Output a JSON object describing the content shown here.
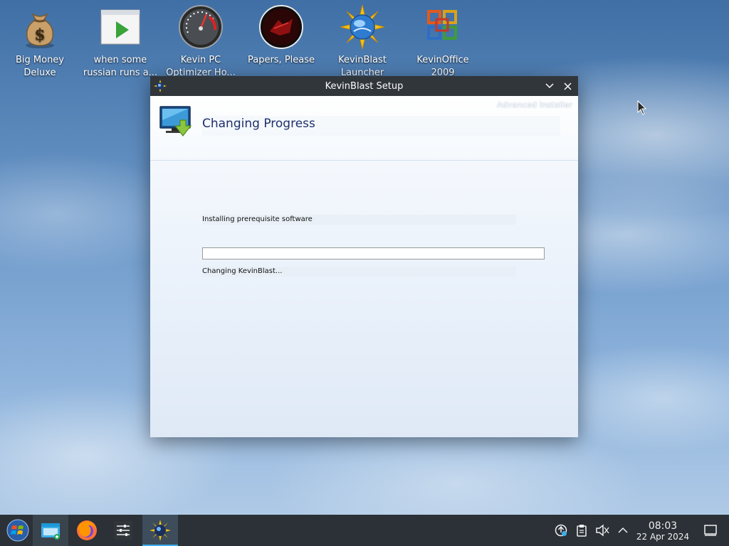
{
  "desktop": {
    "icons": [
      {
        "label_line1": "Big Money",
        "label_line2": "Deluxe",
        "icon": "money-bag-icon"
      },
      {
        "label_line1": "when some",
        "label_line2": "russian runs a...",
        "icon": "video-player-icon"
      },
      {
        "label_line1": "Kevin PC",
        "label_line2": "Optimizer Ho...",
        "icon": "speedometer-icon"
      },
      {
        "label_line1": "Papers, Please",
        "label_line2": "",
        "icon": "papers-please-icon"
      },
      {
        "label_line1": "KevinBlast",
        "label_line2": "Launcher",
        "icon": "kevinblast-sun-icon"
      },
      {
        "label_line1": "KevinOffice",
        "label_line2": "2009",
        "icon": "office-logo-icon"
      }
    ]
  },
  "window": {
    "title": "KevinBlast Setup",
    "brand": "Advanced Installer",
    "heading": "Changing Progress",
    "status_text": "Installing prerequisite software",
    "detail_text": "Changing KevinBlast...",
    "progress_fraction": 0.0,
    "accent_color": "#3a8de0"
  },
  "taskbar": {
    "clock_time": "08:03",
    "clock_date": "22 Apr 2024",
    "items": [
      "start-menu",
      "file-manager",
      "firefox",
      "system-settings",
      "kevinblast-setup"
    ],
    "active_item": "kevinblast-setup",
    "tray_icons": [
      "updates-icon",
      "clipboard-icon",
      "volume-muted-icon",
      "chevron-up-icon"
    ],
    "bar_color": "#2b3136"
  }
}
